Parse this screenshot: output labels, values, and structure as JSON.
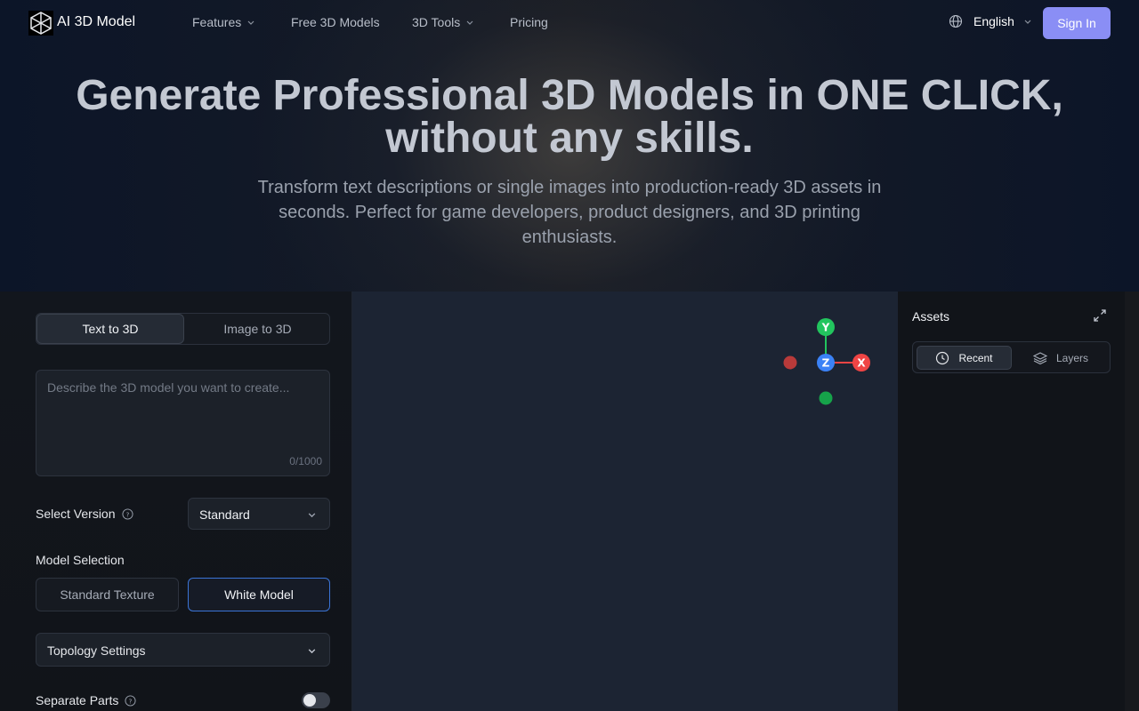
{
  "nav": {
    "brand": "AI 3D Model",
    "items": [
      {
        "label": "Features",
        "has_dropdown": true
      },
      {
        "label": "Free 3D Models",
        "has_dropdown": false
      },
      {
        "label": "3D Tools",
        "has_dropdown": true
      },
      {
        "label": "Pricing",
        "has_dropdown": false
      }
    ],
    "language": "English",
    "sign_in": "Sign In"
  },
  "hero": {
    "title_line1": "Generate Professional 3D Models in ONE CLICK,",
    "title_line2": "without any skills.",
    "subtitle_line1": "Transform text descriptions or single images into production-ready 3D assets in",
    "subtitle_line2": "seconds. Perfect for game developers, product designers, and 3D printing",
    "subtitle_line3": "enthusiasts."
  },
  "generator": {
    "tabs": {
      "text_to_3d": "Text to 3D",
      "image_to_3d": "Image to 3D",
      "active": "text_to_3d"
    },
    "prompt": {
      "placeholder": "Describe the 3D model you want to create...",
      "value": "",
      "counter": "0/1000"
    },
    "version": {
      "label": "Select Version",
      "selected": "Standard"
    },
    "model_selection": {
      "label": "Model Selection",
      "options": [
        "Standard Texture",
        "White Model"
      ],
      "selected": "White Model"
    },
    "topology": {
      "label": "Topology Settings"
    },
    "separate_parts": {
      "label": "Separate Parts",
      "enabled": false
    }
  },
  "viewport": {
    "axis_labels": {
      "y": "Y",
      "z": "Z",
      "x": "X"
    },
    "colors": {
      "x": "#ef4444",
      "y": "#22c55e",
      "z": "#3b82f6",
      "neg_x": "#b83a3a",
      "neg_y": "#16a34a"
    }
  },
  "assets": {
    "title": "Assets",
    "tabs": [
      "Recent",
      "Layers"
    ],
    "active_tab": "Recent"
  },
  "colors": {
    "accent": "#8a8ef5",
    "selected_border": "#3b74d6"
  },
  "icons": [
    "logo-cube-icon",
    "chevron-down-icon",
    "globe-icon",
    "help-circle-icon",
    "expand-icon",
    "clock-icon",
    "layers-icon"
  ]
}
